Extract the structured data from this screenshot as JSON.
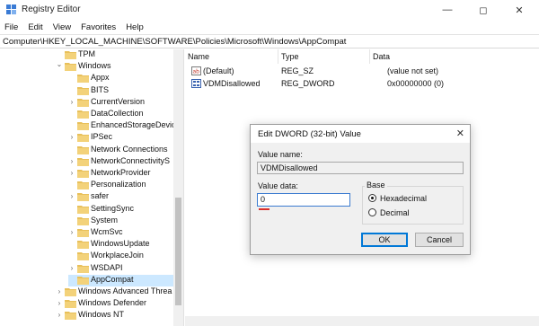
{
  "window": {
    "title": "Registry Editor"
  },
  "menu": [
    "File",
    "Edit",
    "View",
    "Favorites",
    "Help"
  ],
  "address": "Computer\\HKEY_LOCAL_MACHINE\\SOFTWARE\\Policies\\Microsoft\\Windows\\AppCompat",
  "tree": {
    "items": [
      {
        "label": "TPM",
        "depth": 1,
        "expandable": false
      },
      {
        "label": "Windows",
        "depth": 1,
        "expandable": true,
        "expanded": true
      },
      {
        "label": "Appx",
        "depth": 2,
        "expandable": false
      },
      {
        "label": "BITS",
        "depth": 2,
        "expandable": false
      },
      {
        "label": "CurrentVersion",
        "depth": 2,
        "expandable": true
      },
      {
        "label": "DataCollection",
        "depth": 2,
        "expandable": false
      },
      {
        "label": "EnhancedStorageDevic",
        "depth": 2,
        "expandable": false
      },
      {
        "label": "IPSec",
        "depth": 2,
        "expandable": true
      },
      {
        "label": "Network Connections",
        "depth": 2,
        "expandable": false
      },
      {
        "label": "NetworkConnectivityS",
        "depth": 2,
        "expandable": true
      },
      {
        "label": "NetworkProvider",
        "depth": 2,
        "expandable": true
      },
      {
        "label": "Personalization",
        "depth": 2,
        "expandable": false
      },
      {
        "label": "safer",
        "depth": 2,
        "expandable": true
      },
      {
        "label": "SettingSync",
        "depth": 2,
        "expandable": false
      },
      {
        "label": "System",
        "depth": 2,
        "expandable": false
      },
      {
        "label": "WcmSvc",
        "depth": 2,
        "expandable": true
      },
      {
        "label": "WindowsUpdate",
        "depth": 2,
        "expandable": false
      },
      {
        "label": "WorkplaceJoin",
        "depth": 2,
        "expandable": false
      },
      {
        "label": "WSDAPI",
        "depth": 2,
        "expandable": true
      },
      {
        "label": "AppCompat",
        "depth": 2,
        "expandable": false,
        "selected": true
      },
      {
        "label": "Windows Advanced Threa",
        "depth": 1,
        "expandable": true
      },
      {
        "label": "Windows Defender",
        "depth": 1,
        "expandable": true
      },
      {
        "label": "Windows NT",
        "depth": 1,
        "expandable": true
      }
    ]
  },
  "list": {
    "headers": [
      "Name",
      "Type",
      "Data"
    ],
    "rows": [
      {
        "name": "(Default)",
        "type": "REG_SZ",
        "data": "(value not set)",
        "icon": "string-value-icon"
      },
      {
        "name": "VDMDisallowed",
        "type": "REG_DWORD",
        "data": "0x00000000 (0)",
        "icon": "dword-value-icon"
      }
    ]
  },
  "dialog": {
    "title": "Edit DWORD (32-bit) Value",
    "value_name_label": "Value name:",
    "value_name": "VDMDisallowed",
    "value_data_label": "Value data:",
    "value_data": "0",
    "base_label": "Base",
    "base_options": [
      "Hexadecimal",
      "Decimal"
    ],
    "base_selected": "Hexadecimal",
    "ok_label": "OK",
    "cancel_label": "Cancel"
  },
  "colors": {
    "selection": "#cce8ff",
    "accent": "#0078d7",
    "folder": "#e8c05a"
  }
}
